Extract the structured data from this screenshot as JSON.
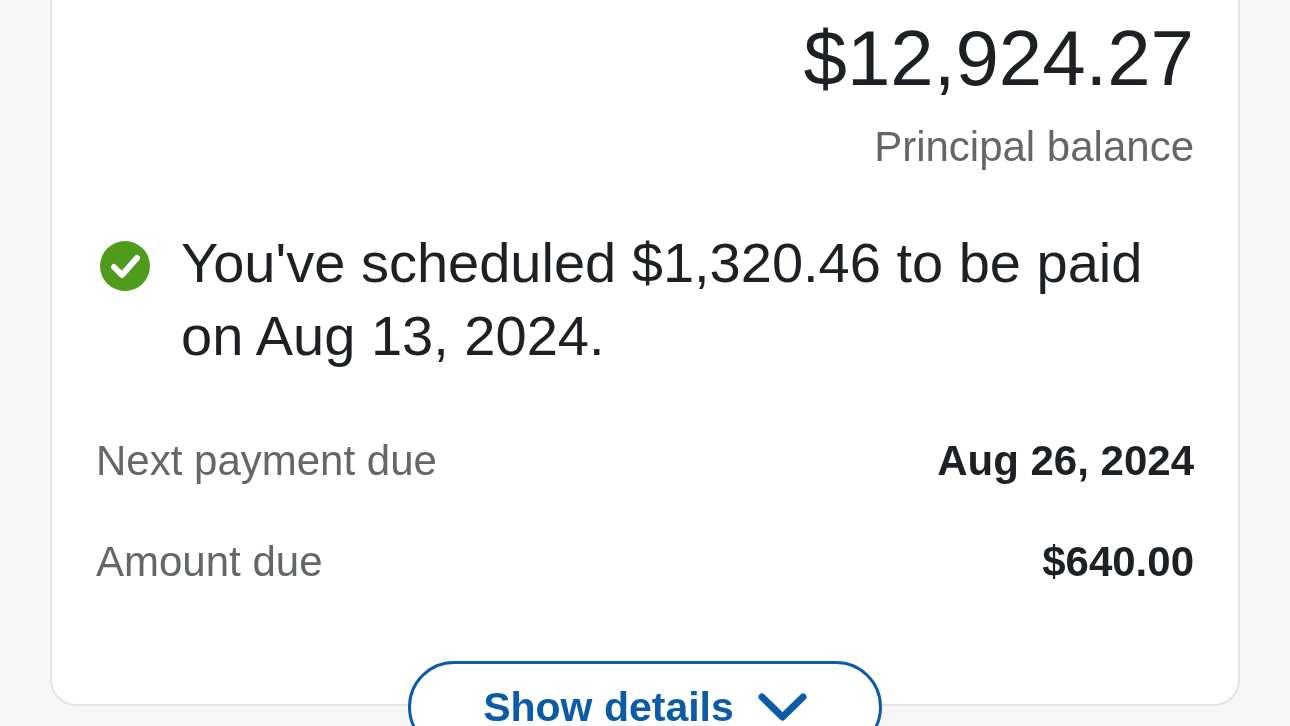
{
  "balance": {
    "amount": "$12,924.27",
    "label": "Principal balance"
  },
  "notice": {
    "kind": "success",
    "text": "You've scheduled $1,320.46 to be paid on Aug 13, 2024."
  },
  "details": [
    {
      "label": "Next payment due",
      "value": "Aug 26, 2024"
    },
    {
      "label": "Amount due",
      "value": "$640.00"
    }
  ],
  "show_details_button": {
    "label": "Show details",
    "expanded": false
  }
}
